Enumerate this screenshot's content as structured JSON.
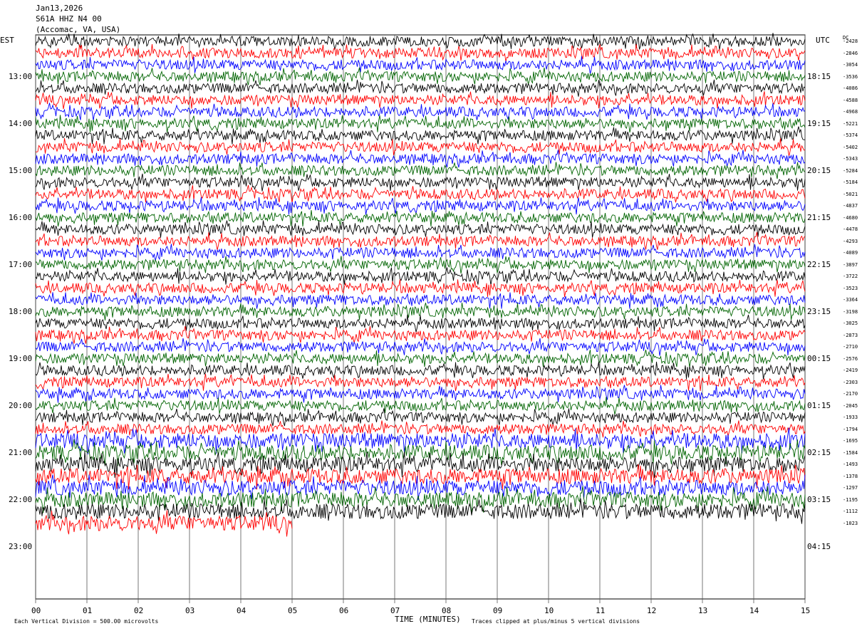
{
  "header": {
    "date": "Jan13,2026",
    "station": "S61A HHZ N4 00",
    "location": "(Accomac, VA, USA)"
  },
  "axes": {
    "left_zone": "EST",
    "right_zone": "UTC",
    "dc_label": "DC",
    "xlabel": "TIME (MINUTES)"
  },
  "footer": {
    "scale_note": "Each Vertical Division =  500.00 microvolts",
    "clip_note": "Traces clipped at plus/minus 5 vertical divisions"
  },
  "colors": {
    "trace_cycle": [
      "#000000",
      "#ff0000",
      "#0000ff",
      "#006400"
    ],
    "grid": "#000000",
    "background": "#ffffff"
  },
  "chart_data": {
    "type": "line",
    "title": "Jan13,2026 S61A HHZ N4 00 (Accomac, VA, USA)",
    "xlabel": "TIME (MINUTES)",
    "xlim": [
      0,
      15
    ],
    "x_ticks": [
      "00",
      "01",
      "02",
      "03",
      "04",
      "05",
      "06",
      "07",
      "08",
      "09",
      "10",
      "11",
      "12",
      "13",
      "14",
      "15"
    ],
    "left_hour_labels": [
      "13:00",
      "14:00",
      "15:00",
      "16:00",
      "17:00",
      "18:00",
      "19:00",
      "20:00",
      "21:00",
      "22:00",
      "23:00"
    ],
    "right_hour_labels": [
      "18:15",
      "19:15",
      "20:15",
      "21:15",
      "22:15",
      "23:15",
      "00:15",
      "01:15",
      "02:15",
      "03:15",
      "04:15"
    ],
    "traces_per_hour": 4,
    "first_trace_offset": 3,
    "total_trace_rows": 44,
    "active_traces": 42,
    "last_trace_minutes": 5,
    "dc_offsets": [
      "-2428",
      "-2846",
      "-3054",
      "-3536",
      "-4086",
      "-4588",
      "-4968",
      "-5221",
      "-5374",
      "-5402",
      "-5343",
      "-5284",
      "-5184",
      "-5021",
      "-4837",
      "-4680",
      "-4478",
      "-4293",
      "-4089",
      "-3897",
      "-3722",
      "-3523",
      "-3364",
      "-3198",
      "-3025",
      "-2873",
      "-2710",
      "-2576",
      "-2419",
      "-2303",
      "-2170",
      "-2045",
      "-1933",
      "-1794",
      "-1695",
      "-1584",
      "-1493",
      "-1378",
      "-1297",
      "-1195",
      "-1112",
      "-1023"
    ],
    "grid": true
  }
}
